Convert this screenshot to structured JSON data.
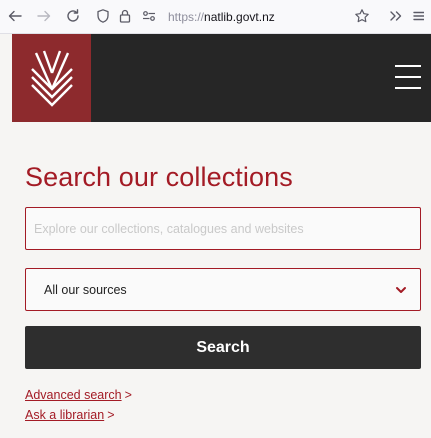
{
  "browser": {
    "url_scheme": "https://",
    "url_host": "natlib.govt.nz",
    "icons": [
      "back-arrow-icon",
      "forward-arrow-icon",
      "reload-icon",
      "tracking-shield-icon",
      "lock-icon",
      "permissions-icon",
      "bookmark-star-icon",
      "overflow-chevrons-icon",
      "app-menu-icon"
    ]
  },
  "header": {
    "logo_icon": "natlib-logo-icon",
    "menu_icon": "hamburger-menu-icon"
  },
  "search": {
    "title": "Search our collections",
    "placeholder": "Explore our collections, catalogues and websites",
    "source_selected": "All our sources",
    "button_label": "Search"
  },
  "links": {
    "advanced": "Advanced search",
    "librarian": "Ask a librarian",
    "arrow": ">"
  },
  "colors": {
    "brand_red": "#a31b25",
    "logo_bg": "#8d2a2d",
    "header_bg": "#262626",
    "button_bg": "#2e2e2e",
    "page_bg": "#f6f5f3"
  }
}
